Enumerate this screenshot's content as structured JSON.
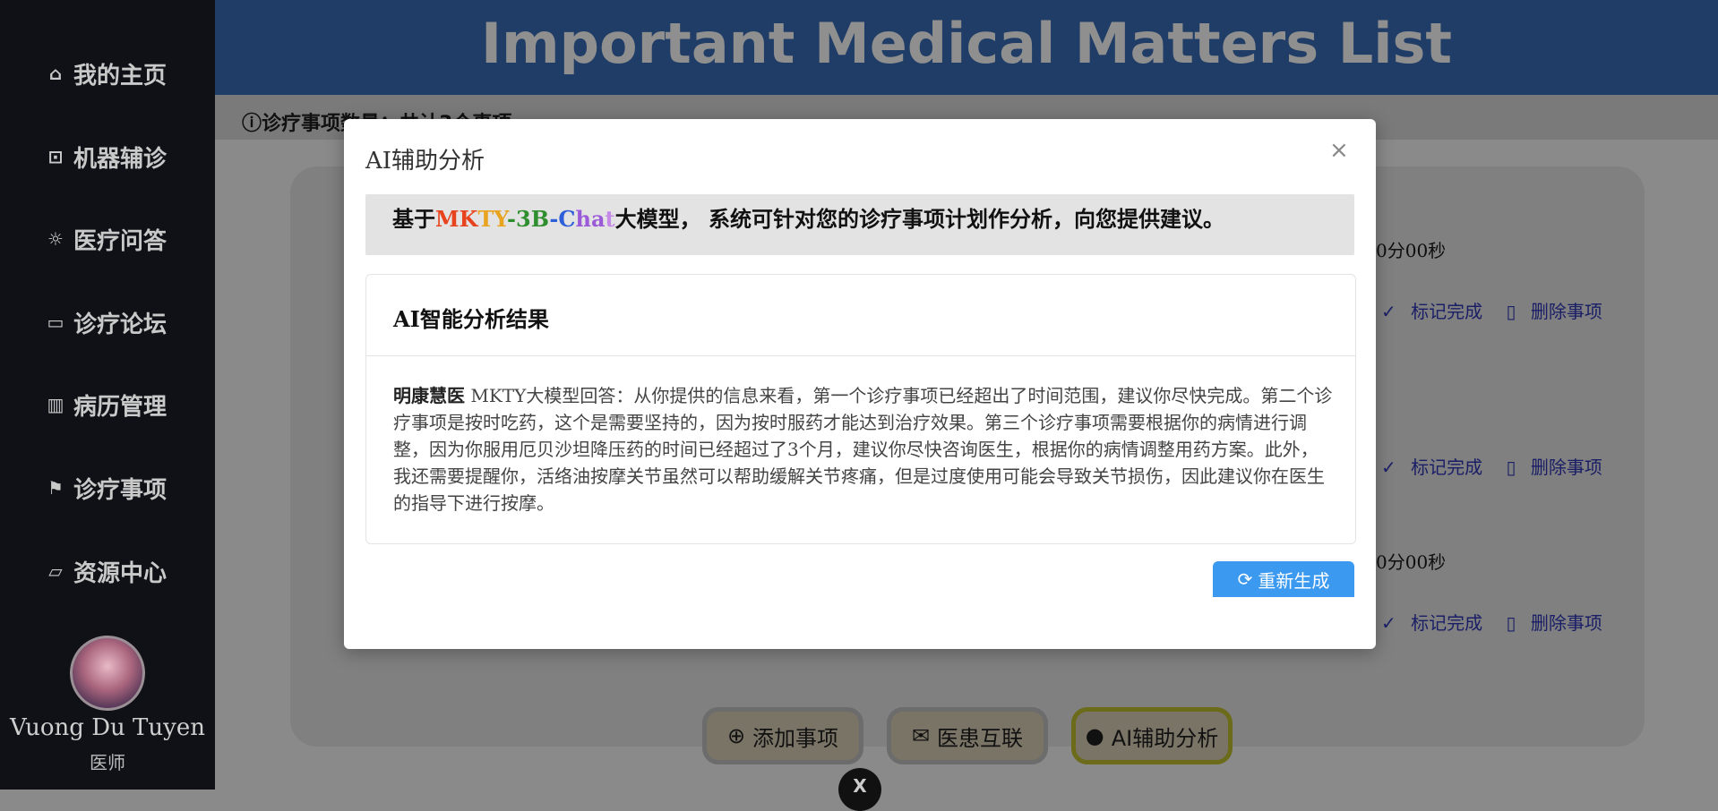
{
  "app": {
    "title": "Important Medical Matters List",
    "subbar_text": "诊疗事项数量：共计3个事项"
  },
  "sidebar": {
    "items": [
      {
        "label": "我的主页",
        "icon": "home-icon"
      },
      {
        "label": "机器辅诊",
        "icon": "robot-icon"
      },
      {
        "label": "医疗问答",
        "icon": "sun-icon"
      },
      {
        "label": "诊疗论坛",
        "icon": "chat-icon"
      },
      {
        "label": "病历管理",
        "icon": "records-icon"
      },
      {
        "label": "诊疗事项",
        "icon": "flag-icon"
      },
      {
        "label": "资源中心",
        "icon": "folder-icon"
      }
    ],
    "user_name": "Vuong Du Tuyen",
    "user_role": "医师"
  },
  "items": [
    {
      "time_text": "0分00秒",
      "mark_done": "标记完成",
      "delete": "删除事项"
    },
    {
      "time_text": "",
      "mark_done": "标记完成",
      "delete": "删除事项"
    },
    {
      "time_text": "0分00秒",
      "mark_done": "标记完成",
      "delete": "删除事项"
    }
  ],
  "bottom_buttons": {
    "add": "添加事项",
    "connect": "医患互联",
    "ai": "AI辅助分析",
    "close_icon_text": "X"
  },
  "modal": {
    "title": "AI辅助分析",
    "close_symbol": "×",
    "banner_prefix": "基于",
    "banner_model_chars": [
      "M",
      "K",
      "T",
      "Y",
      "-",
      "3",
      "B",
      "-",
      "C",
      "h",
      "a",
      "t"
    ],
    "banner_suffix": "大模型， 系统可针对您的诊疗事项计划作分析，向您提供建议。",
    "result_title": "AI智能分析结果",
    "result_speaker": "明康慧医",
    "result_text": " MKTY大模型回答：从你提供的信息来看，第一个诊疗事项已经超出了时间范围，建议你尽快完成。第二个诊疗事项是按时吃药，这个是需要坚持的，因为按时服药才能达到治疗效果。第三个诊疗事项需要根据你的病情进行调整，因为你服用厄贝沙坦降压药的时间已经超过了3个月，建议你尽快咨询医生，根据你的病情调整用药方案。此外，我还需要提醒你，活络油按摩关节虽然可以帮助缓解关节疼痛，但是过度使用可能会导致关节损伤，因此建议你在医生的指导下进行按摩。",
    "regen_label": "重新生成"
  },
  "colors": {
    "accent": "#3b99f0",
    "sidebar_bg": "#0f1116",
    "header_bg": "#1f3d66"
  }
}
